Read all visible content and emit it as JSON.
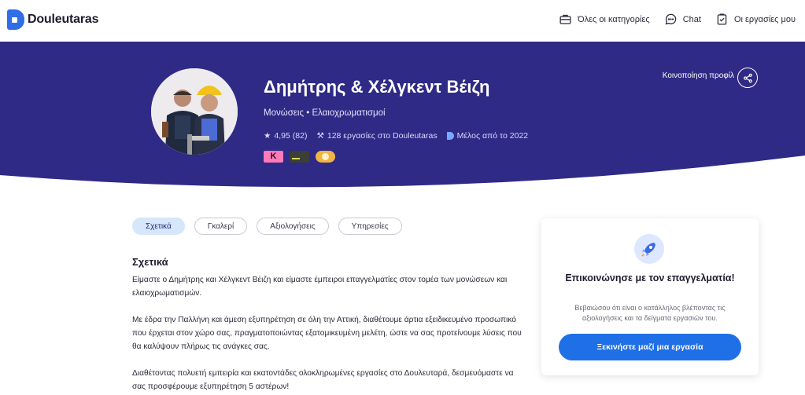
{
  "brand": {
    "name": "Douleutaras"
  },
  "nav": {
    "all_categories": "Όλες οι κατηγορίες",
    "chat": "Chat",
    "my_jobs": "Οι εργασίες μου"
  },
  "profile": {
    "name": "Δημήτρης & Χέλγκεντ Βέιζη",
    "services": "Μονώσεις • Ελαιοχρωματισμοί",
    "rating": "4,95 (82)",
    "jobs": "128 εργασίες στο Douleutaras",
    "member_since": "Μέλος από το 2022",
    "badge_k": "K",
    "share_label": "Κοινοποίηση προφίλ"
  },
  "tabs": [
    "Σχετικά",
    "Γκαλερί",
    "Αξιολογήσεις",
    "Υπηρεσίες"
  ],
  "about": {
    "title": "Σχετικά",
    "p1": "Είμαστε ο Δημήτρης και Χέλγκεντ Βέιζη και είμαστε έμπειροι επαγγελματίες στον τομέα των μονώσεων και ελαιοχρωματισμών.",
    "p2": "Με έδρα την Παλλήνη και άμεση εξυπηρέτηση σε όλη την Αττική, διαθέτουμε άρτια εξειδικευμένο προσωπικό που έρχεται στον χώρο σας, πραγματοποιώντας εξατομικευμένη μελέτη, ώστε να σας προτείνουμε λύσεις που θα καλύψουν πλήρως τις ανάγκες σας.",
    "p3": "Διαθέτοντας πολυετή εμπειρία και εκατοντάδες ολοκληρωμένες εργασίες στο Δουλευταρά, δεσμευόμαστε να σας προσφέρουμε εξυπηρέτηση 5 αστέρων!"
  },
  "contact": {
    "title": "Επικοινώνησε με τον επαγγελματία!",
    "subtitle": "Βεβαιώσου ότι είναι ο κατάλληλος βλέποντας τις αξιολογήσεις και τα δείγματα εργασιών του.",
    "cta": "Ξεκινήστε μαζί μια εργασία"
  },
  "colors": {
    "hero_bg": "#2e2a85",
    "accent": "#1f6fe6",
    "tab_active_bg": "#d6e6fb"
  }
}
